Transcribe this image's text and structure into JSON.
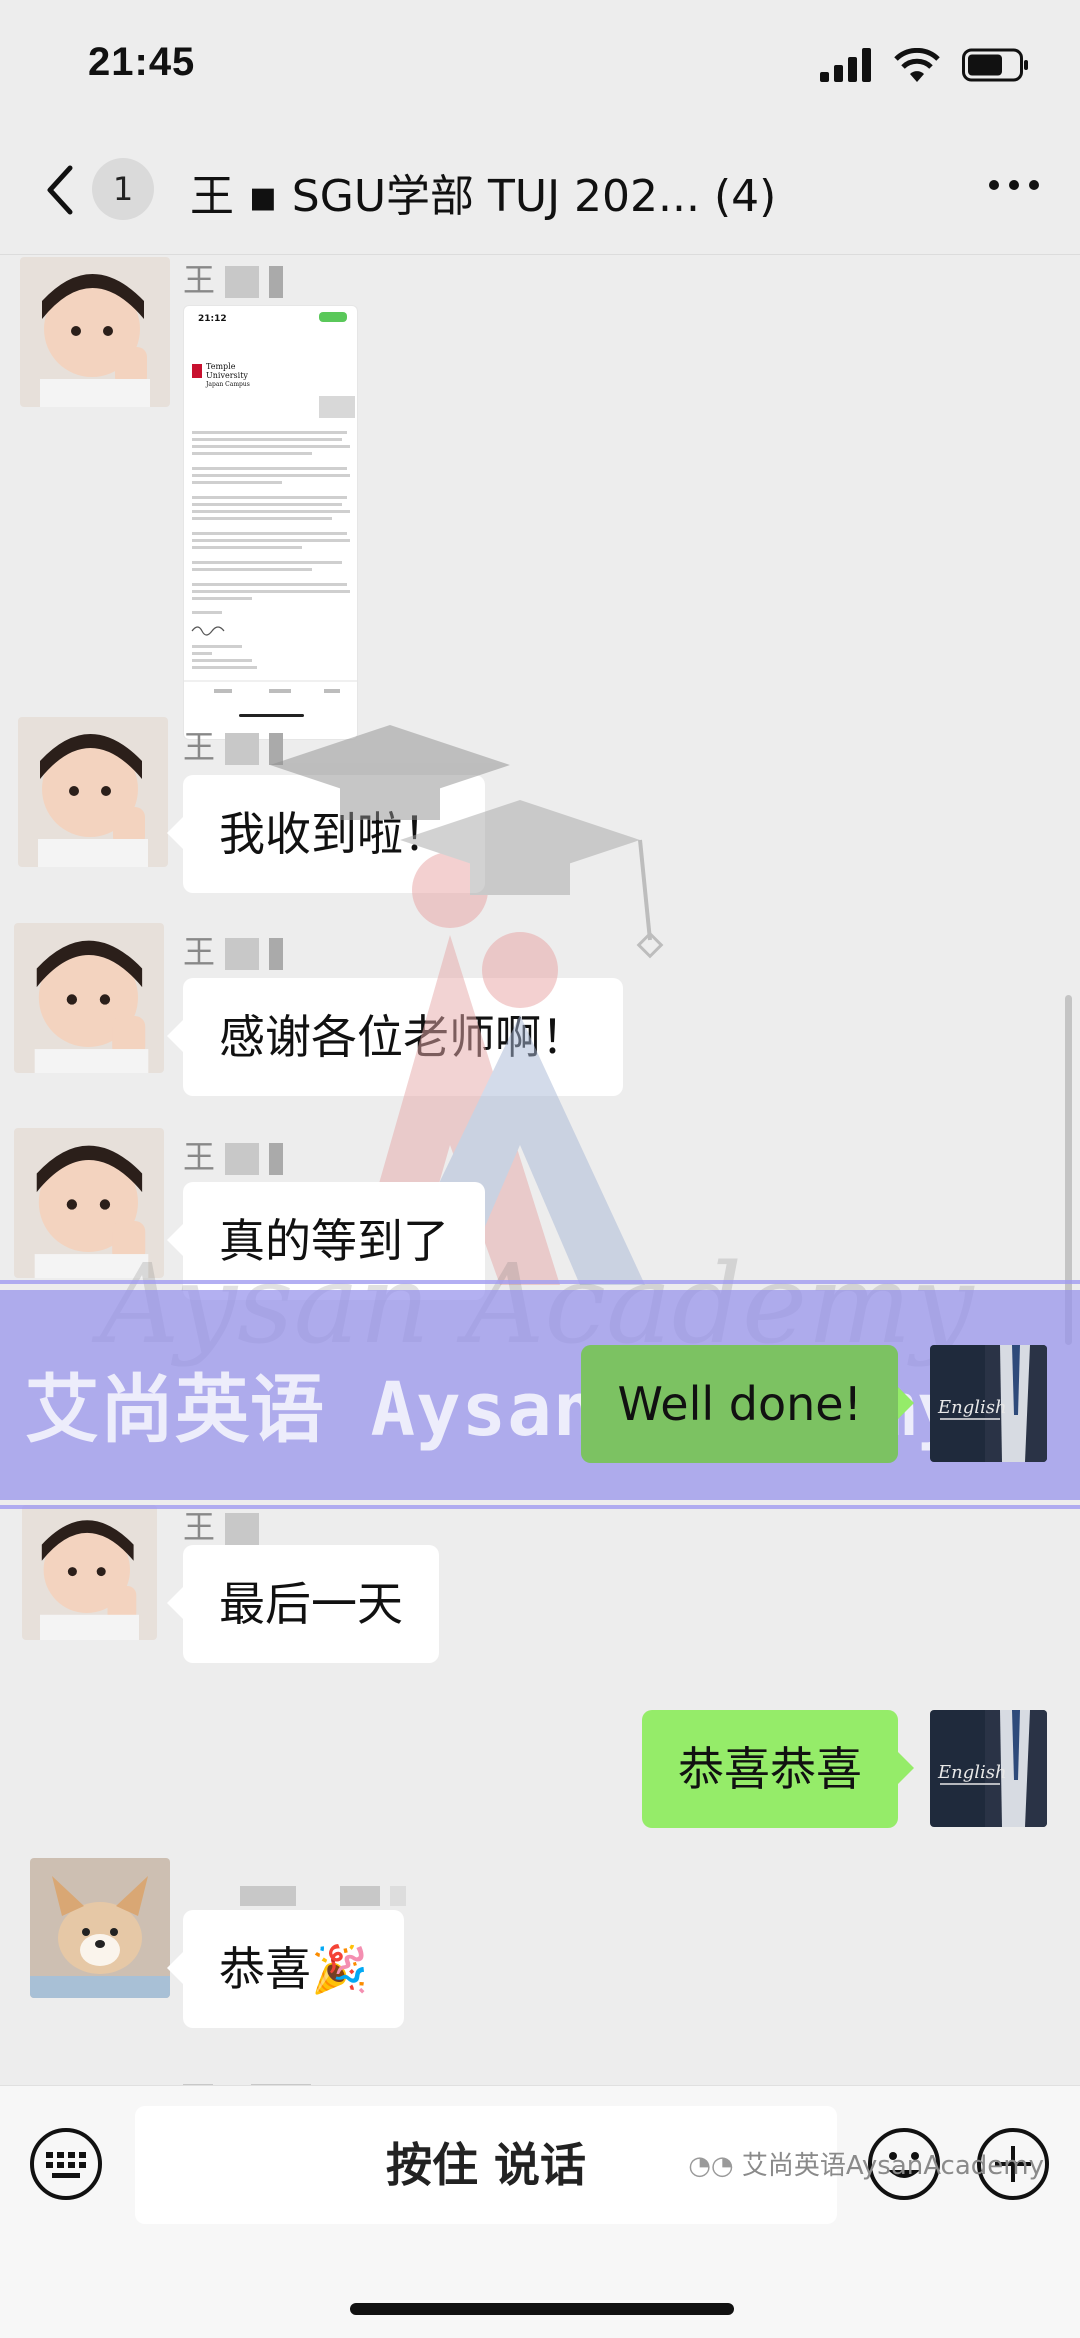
{
  "status": {
    "time": "21:45"
  },
  "nav": {
    "unread_count": "1",
    "title": "王 ▪ SGU学部 TUJ 202... (4)"
  },
  "messages": [
    {
      "type": "image",
      "side": "left",
      "name_prefix": "王"
    },
    {
      "type": "text",
      "side": "left",
      "name_prefix": "王",
      "text": "我收到啦！"
    },
    {
      "type": "text",
      "side": "left",
      "name_prefix": "王",
      "text": "感谢各位老师啊！"
    },
    {
      "type": "text",
      "side": "left",
      "name_prefix": "王",
      "text": "真的等到了"
    },
    {
      "type": "text",
      "side": "right",
      "text": "Well done!"
    },
    {
      "type": "text",
      "side": "left",
      "name_prefix": "王",
      "text": "最后一天"
    },
    {
      "type": "text",
      "side": "right",
      "text": "恭喜恭喜"
    },
    {
      "type": "text",
      "side": "left",
      "name_prefix": "",
      "text": "恭喜🎉"
    }
  ],
  "image_preview": {
    "time": "21:12",
    "school_line1": "Temple",
    "school_line2": "University",
    "school_line3": "Japan Campus"
  },
  "watermark": {
    "band_text": "艾尚英语 Aysan Academy",
    "script_text": "Aysan Academy"
  },
  "input": {
    "voice_label": "按住 说话"
  },
  "footer": {
    "source_label": "艾尚英语AysanAcademy"
  },
  "colors": {
    "background": "#ededed",
    "right_bubble": "#95ec69",
    "left_bubble": "#ffffff",
    "watermark_band": "#9691eb"
  }
}
